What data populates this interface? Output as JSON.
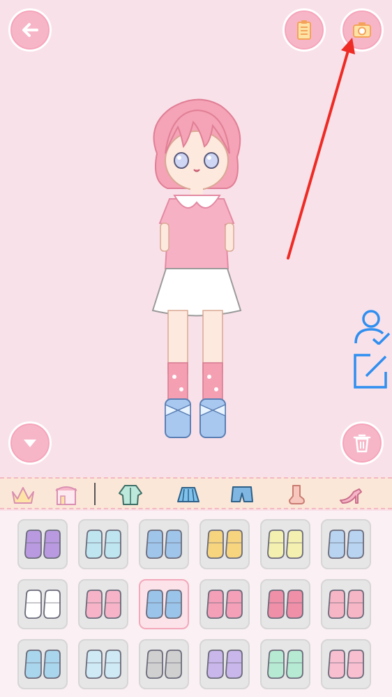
{
  "toolbar": {
    "back_icon": "back-arrow-icon",
    "list_icon": "clipboard-list-icon",
    "camera_icon": "camera-icon",
    "down_icon": "chevron-down-icon",
    "trash_icon": "trash-icon"
  },
  "side": {
    "profile_icon": "user-check-icon",
    "edit_icon": "edit-icon"
  },
  "tabs": [
    {
      "icon": "crown-icon"
    },
    {
      "icon": "shop-icon"
    },
    {
      "icon": "jacket-icon"
    },
    {
      "icon": "skirt-icon"
    },
    {
      "icon": "shorts-icon"
    },
    {
      "icon": "sock-icon"
    },
    {
      "icon": "high-heel-icon"
    }
  ],
  "items": [
    {
      "icon": "purple-pompom-slippers",
      "color": "#b99ae0"
    },
    {
      "icon": "ribbon-sandals",
      "color": "#bfe6f0"
    },
    {
      "icon": "blue-heart-shoes",
      "color": "#9fc6ea"
    },
    {
      "icon": "yellow-socks-shoes",
      "color": "#f7d47e"
    },
    {
      "icon": "cream-flats",
      "color": "#f4f0b0"
    },
    {
      "icon": "blue-bow-boots",
      "color": "#b8d4f0"
    },
    {
      "icon": "bear-slippers",
      "color": "#ffffff"
    },
    {
      "icon": "pink-star-shoes",
      "color": "#f7b4c8"
    },
    {
      "icon": "blue-boots",
      "color": "#9ac4ea"
    },
    {
      "icon": "pink-bow-heels",
      "color": "#f3a0b8"
    },
    {
      "icon": "pink-frill-boots",
      "color": "#f08fa8"
    },
    {
      "icon": "pink-sneakers",
      "color": "#f7b6c6"
    },
    {
      "icon": "blue-high-boots",
      "color": "#a9d6ec"
    },
    {
      "icon": "bunny-boots",
      "color": "#cfeaf4"
    },
    {
      "icon": "grey-sneakers",
      "color": "#d0d0d0"
    },
    {
      "icon": "purple-lace-boots",
      "color": "#c9b6ea"
    },
    {
      "icon": "mint-pompom-sandals",
      "color": "#b7ead2"
    },
    {
      "icon": "pink-slippers",
      "color": "#f7bfd0"
    }
  ],
  "colors": {
    "accent": "#f7b6c8",
    "background": "#f9e1e9",
    "side_icon": "#2f8ff0"
  }
}
